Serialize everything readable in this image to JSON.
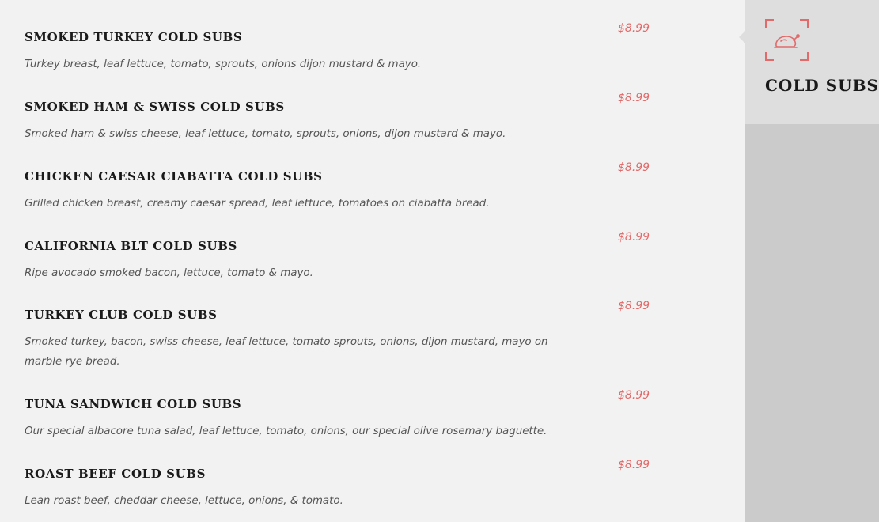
{
  "menu": {
    "items": [
      {
        "title": "SMOKED TURKEY COLD SUBS",
        "price": "$8.99",
        "description": "Turkey breast, leaf lettuce, tomato, sprouts, onions dijon mustard & mayo."
      },
      {
        "title": "SMOKED HAM & SWISS COLD SUBS",
        "price": "$8.99",
        "description": "Smoked ham & swiss cheese, leaf lettuce, tomato, sprouts, onions, dijon mustard & mayo."
      },
      {
        "title": "CHICKEN CAESAR CIABATTA COLD SUBS",
        "price": "$8.99",
        "description": "Grilled chicken breast, creamy caesar spread, leaf lettuce, tomatoes on ciabatta bread."
      },
      {
        "title": "CALIFORNIA BLT COLD SUBS",
        "price": "$8.99",
        "description": "Ripe avocado smoked bacon, lettuce, tomato & mayo."
      },
      {
        "title": "TURKEY CLUB COLD SUBS",
        "price": "$8.99",
        "description": "Smoked turkey, bacon, swiss cheese, leaf lettuce, tomato sprouts, onions, dijon mustard, mayo on marble rye bread."
      },
      {
        "title": "TUNA SANDWICH COLD SUBS",
        "price": "$8.99",
        "description": "Our special albacore tuna salad, leaf lettuce, tomato, onions, our special olive rosemary baguette."
      },
      {
        "title": "ROAST BEEF COLD SUBS",
        "price": "$8.99",
        "description": "Lean roast beef, cheddar cheese, lettuce, onions, & tomato."
      }
    ]
  },
  "sidebar": {
    "active_category": {
      "label": "COLD SUBS",
      "icon": "roast-chicken-icon"
    }
  },
  "colors": {
    "accent": "#e26a6a",
    "page_background": "#f2f2f2",
    "active_tab": "#dedede",
    "sidebar_background": "#cbcbcb"
  }
}
